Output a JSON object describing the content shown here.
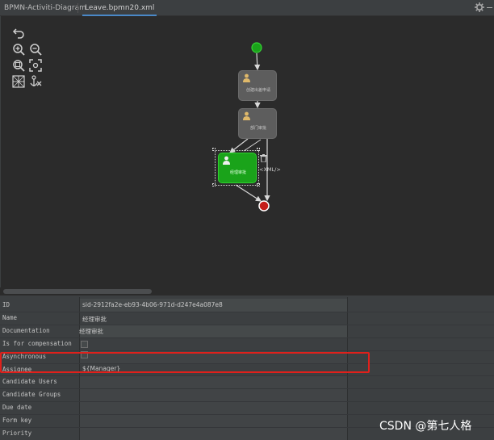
{
  "tabs": [
    {
      "label": "BPMN-Activiti-Diagram"
    },
    {
      "label": "Leave.bpmn20.xml"
    }
  ],
  "diagram": {
    "tasks": [
      {
        "label": "创建出差申请"
      },
      {
        "label": "部门审批"
      },
      {
        "label": "经理审批"
      }
    ],
    "xml_tag": "<XML/>"
  },
  "properties": {
    "rows": [
      {
        "label": "ID",
        "value": "sid-2912fa2e-eb93-4b06-971d-d247e4a087e8"
      },
      {
        "label": "Name",
        "value": "经理审批"
      },
      {
        "label": "Documentation",
        "value": "经理审批"
      },
      {
        "label": "Is for compensation",
        "value": ""
      },
      {
        "label": "Asynchronous",
        "value": ""
      },
      {
        "label": "Assignee",
        "value": "${Manager}"
      },
      {
        "label": "Candidate Users",
        "value": ""
      },
      {
        "label": "Candidate Groups",
        "value": ""
      },
      {
        "label": "Due date",
        "value": ""
      },
      {
        "label": "Form key",
        "value": ""
      },
      {
        "label": "Priority",
        "value": ""
      }
    ]
  },
  "watermark": "CSDN @第七人格",
  "colors": {
    "selected_task": "#1aa31a",
    "start_event": "#1aa31a",
    "end_event": "#e0201b",
    "highlight": "#e0201b",
    "tab_underline": "#4a88c7"
  }
}
